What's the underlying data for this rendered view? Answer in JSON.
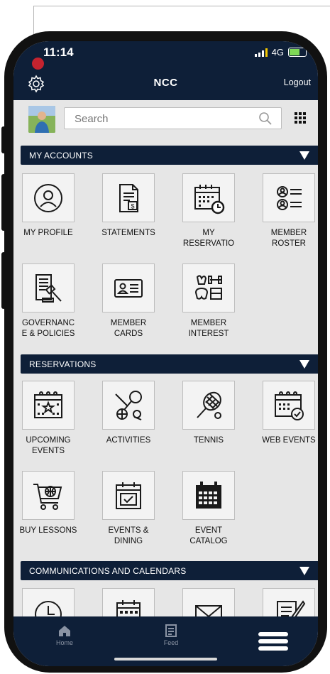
{
  "status_bar": {
    "time": "11:14",
    "network": "4G"
  },
  "header": {
    "title": "NCC",
    "logout_label": "Logout"
  },
  "search": {
    "placeholder": "Search"
  },
  "sections": [
    {
      "title": "MY ACCOUNTS",
      "tiles": [
        {
          "label": "MY PROFILE",
          "icon": "profile-icon"
        },
        {
          "label": "STATEMENTS",
          "icon": "statement-icon"
        },
        {
          "label": "MY\nRESERVATIO",
          "icon": "calendar-clock-icon"
        },
        {
          "label": "MEMBER\nROSTER",
          "icon": "roster-icon"
        },
        {
          "label": "GOVERNANC\nE & POLICIES",
          "icon": "gavel-document-icon"
        },
        {
          "label": "MEMBER\nCARDS",
          "icon": "id-card-icon"
        },
        {
          "label": "MEMBER\nINTEREST",
          "icon": "interests-icon"
        }
      ]
    },
    {
      "title": "RESERVATIONS",
      "tiles": [
        {
          "label": "UPCOMING\nEVENTS",
          "icon": "calendar-star-icon"
        },
        {
          "label": "ACTIVITIES",
          "icon": "sports-icon"
        },
        {
          "label": "TENNIS",
          "icon": "tennis-racket-icon"
        },
        {
          "label": "WEB EVENTS",
          "icon": "calendar-check-icon"
        },
        {
          "label": "BUY LESSONS",
          "icon": "web-cart-icon"
        },
        {
          "label": "EVENTS &\nDINING",
          "icon": "calendar-check-box-icon"
        },
        {
          "label": "EVENT\nCATALOG",
          "icon": "calendar-grid-icon"
        }
      ]
    },
    {
      "title": "COMMUNICATIONS AND CALENDARS",
      "tiles": [
        {
          "label": "",
          "icon": "clock-icon"
        },
        {
          "label": "",
          "icon": "calendar-icon"
        },
        {
          "label": "",
          "icon": "envelope-icon"
        },
        {
          "label": "",
          "icon": "note-edit-icon"
        }
      ]
    }
  ],
  "bottom_nav": {
    "home_label": "Home",
    "feed_label": "Feed"
  },
  "colors": {
    "navy": "#0e1f38",
    "background": "#e6e6e6",
    "record_dot": "#c4232f"
  }
}
